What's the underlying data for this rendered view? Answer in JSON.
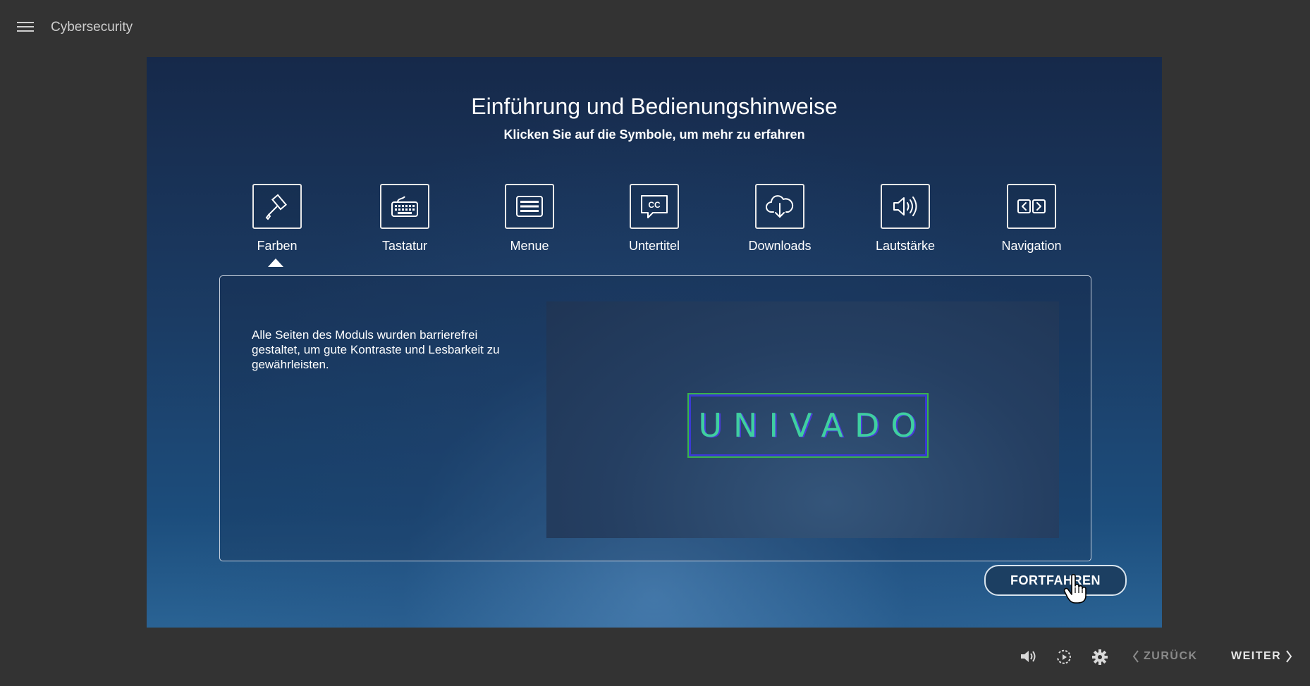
{
  "header": {
    "title": "Cybersecurity"
  },
  "stage": {
    "title": "Einführung und Bedienungshinweise",
    "subtitle": "Klicken Sie auf die Symbole, um mehr zu erfahren",
    "icons": [
      {
        "label": "Farben",
        "icon": "paint-roller-icon"
      },
      {
        "label": "Tastatur",
        "icon": "keyboard-icon"
      },
      {
        "label": "Menue",
        "icon": "menu-icon"
      },
      {
        "label": "Untertitel",
        "icon": "closed-caption-icon",
        "glyph": "CC"
      },
      {
        "label": "Downloads",
        "icon": "cloud-download-icon"
      },
      {
        "label": "Lautstärke",
        "icon": "volume-icon"
      },
      {
        "label": "Navigation",
        "icon": "navigation-arrows-icon"
      }
    ],
    "selected": "Farben",
    "panel_text": "Alle Seiten des Moduls wurden barrierefrei gestaltet, um gute Kontraste und Lesbarkeit zu gewährleisten.",
    "logo_text": "UNIVADO",
    "continue_label": "FORTFAHREN"
  },
  "footer": {
    "back_label": "ZURÜCK",
    "next_label": "WEITER",
    "controls": [
      "volume-icon",
      "replay-icon",
      "settings-icon"
    ]
  },
  "colors": {
    "background": "#333333",
    "stage_dark": "#16294a",
    "logo_green": "#39b24a",
    "logo_blue": "#3a3ad0"
  }
}
